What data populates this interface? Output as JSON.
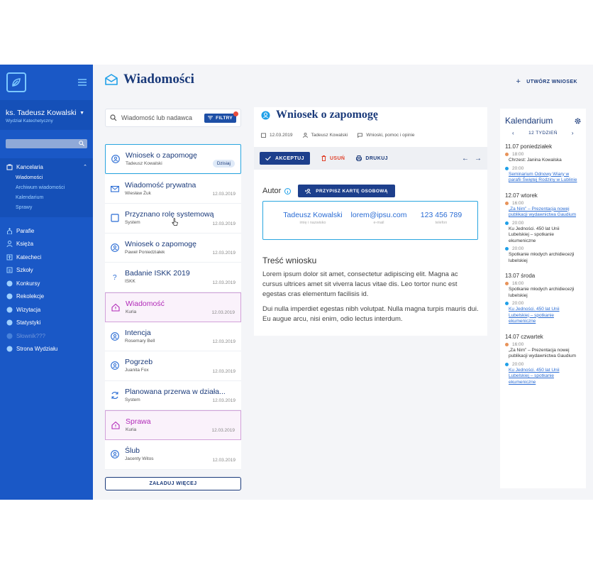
{
  "sidebar": {
    "user_name": "ks. Tadeusz Kowalski",
    "user_department": "Wydział Katechetyczny",
    "section": {
      "label": "Kancelaria",
      "subitems": [
        "Wiadomości",
        "Archiwum wiadomości",
        "Kalendarium",
        "Sprawy"
      ]
    },
    "items": [
      {
        "label": "Parafie",
        "icon": "church-icon"
      },
      {
        "label": "Księża",
        "icon": "priest-icon"
      },
      {
        "label": "Katecheci",
        "icon": "catechist-icon"
      },
      {
        "label": "Szkoły",
        "icon": "school-icon"
      },
      {
        "label": "Konkursy",
        "icon": "trophy-icon"
      },
      {
        "label": "Rekolekcje",
        "icon": "retreat-icon"
      },
      {
        "label": "Wizytacja",
        "icon": "visitation-icon"
      },
      {
        "label": "Statystyki",
        "icon": "stats-icon"
      },
      {
        "label": "Słownik???",
        "icon": "dictionary-icon",
        "disabled": true
      },
      {
        "label": "Strona Wydziału",
        "icon": "globe-icon"
      }
    ]
  },
  "header": {
    "title": "Wiadomości",
    "action_label": "UTWÓRZ WNIOSEK"
  },
  "search": {
    "placeholder": "Wiadomość lub nadawca",
    "filters_label": "FILTRY"
  },
  "messages": [
    {
      "title": "Wniosek o zapomogę",
      "sender": "Tadeusz Kowalski",
      "date": "Dzisiaj",
      "icon": "person-icon",
      "state": "active"
    },
    {
      "title": "Wiadomość prywatna",
      "sender": "Wiesław Żuk",
      "date": "12.03.2019",
      "icon": "envelope-icon",
      "state": ""
    },
    {
      "title": "Przyznano rolę systemową",
      "sender": "System",
      "date": "12.03.2019",
      "icon": "square-icon",
      "state": ""
    },
    {
      "title": "Wniosek o zapomogę",
      "sender": "Paweł Poniedziałek",
      "date": "12.03.2019",
      "icon": "person-icon",
      "state": ""
    },
    {
      "title": "Badanie ISKK 2019",
      "sender": "ISKK",
      "date": "12.03.2019",
      "icon": "question-icon",
      "state": ""
    },
    {
      "title": "Wiadomość",
      "sender": "Kuria",
      "date": "12.03.2019",
      "icon": "house-icon",
      "state": "highlight"
    },
    {
      "title": "Intencja",
      "sender": "Rosemary Bell",
      "date": "12.03.2019",
      "icon": "person-icon",
      "state": ""
    },
    {
      "title": "Pogrzeb",
      "sender": "Juanita Fox",
      "date": "12.03.2019",
      "icon": "person-icon",
      "state": ""
    },
    {
      "title": "Planowana przerwa w działa...",
      "sender": "System",
      "date": "12.03.2019",
      "icon": "refresh-icon",
      "state": ""
    },
    {
      "title": "Sprawa",
      "sender": "Kuria",
      "date": "12.03.2019",
      "icon": "house-icon",
      "state": "highlight"
    },
    {
      "title": "Ślub",
      "sender": "Jacenty Witos",
      "date": "12.03.2019",
      "icon": "person-icon",
      "state": ""
    }
  ],
  "load_more_label": "ZAŁADUJ WIĘCEJ",
  "detail": {
    "title": "Wniosek o zapomogę",
    "date": "12.03.2019",
    "author": "Tadeusz Kowalski",
    "category": "Wnioski, pomoc i opinie",
    "toolbar": {
      "accept": "AKCEPTUJ",
      "delete": "USUŃ",
      "print": "DRUKUJ"
    },
    "author_label": "Autor",
    "assign_label": "PRZYPISZ KARTĘ OSOBOWĄ",
    "contact": {
      "name": "Tadeusz Kowalski",
      "name_label": "imię i nazwisko",
      "email": "lorem@ipsu.com",
      "email_label": "e-mail",
      "phone": "123 456 789",
      "phone_label": "telefon"
    },
    "content_title": "Treść wniosku",
    "paragraphs": [
      "Lorem ipsum dolor sit amet, consectetur adipiscing elit. Magna ac cursus ultrices amet sit viverra lacus vitae dis. Leo tortor nunc est egestas cras elementum facilisis id.",
      "Dui nulla imperdiet egestas nibh volutpat. Nulla magna turpis mauris dui. Eu augue arcu, nisi enim, odio lectus interdum."
    ]
  },
  "calendar": {
    "title": "Kalendarium",
    "week": "12 TYDZIEŃ",
    "colors": {
      "orange": "#e8935a",
      "blue": "#1fa0e8"
    },
    "days": [
      {
        "label": "11.07 poniedziałek",
        "events": [
          {
            "time": "18:00",
            "text": "Chrzest: Janina Kowalska",
            "dot": "orange",
            "link": false
          },
          {
            "time": "20:00",
            "text": "Seminarium Odnowy Wiary w parafii Świętej Rodziny w Lublinie",
            "dot": "blue",
            "link": true
          }
        ]
      },
      {
        "label": "12.07 wtorek",
        "events": [
          {
            "time": "16:00",
            "text": "„Za Nim” – Prezentacja nowej publikacji wydawnictwa Gaudium",
            "dot": "orange",
            "link": true
          },
          {
            "time": "20:00",
            "text": "Ku Jedności. 450 lat Unii Lubelskiej – spotkanie ekumeniczne",
            "dot": "blue",
            "link": false
          },
          {
            "time": "20:00",
            "text": "Spotkanie młodych archidiecezji lubelskiej",
            "dot": "blue",
            "link": false
          }
        ]
      },
      {
        "label": "13.07 środa",
        "events": [
          {
            "time": "16:00",
            "text": "Spotkanie młodych archidiecezji lubelskiej",
            "dot": "orange",
            "link": false
          },
          {
            "time": "20:00",
            "text": "Ku Jedności. 450 lat Unii Lubelskiej – spotkanie ekumeniczne",
            "dot": "blue",
            "link": true
          }
        ]
      },
      {
        "label": "14.07 czwartek",
        "events": [
          {
            "time": "16:00",
            "text": "„Za Nim” – Prezentacja nowej publikacji wydawnictwa Gaudium",
            "dot": "orange",
            "link": false
          },
          {
            "time": "20:00",
            "text": "Ku Jedności. 450 lat Unii Lubelskiej – spotkanie ekumeniczne",
            "dot": "blue",
            "link": true
          }
        ]
      }
    ]
  }
}
